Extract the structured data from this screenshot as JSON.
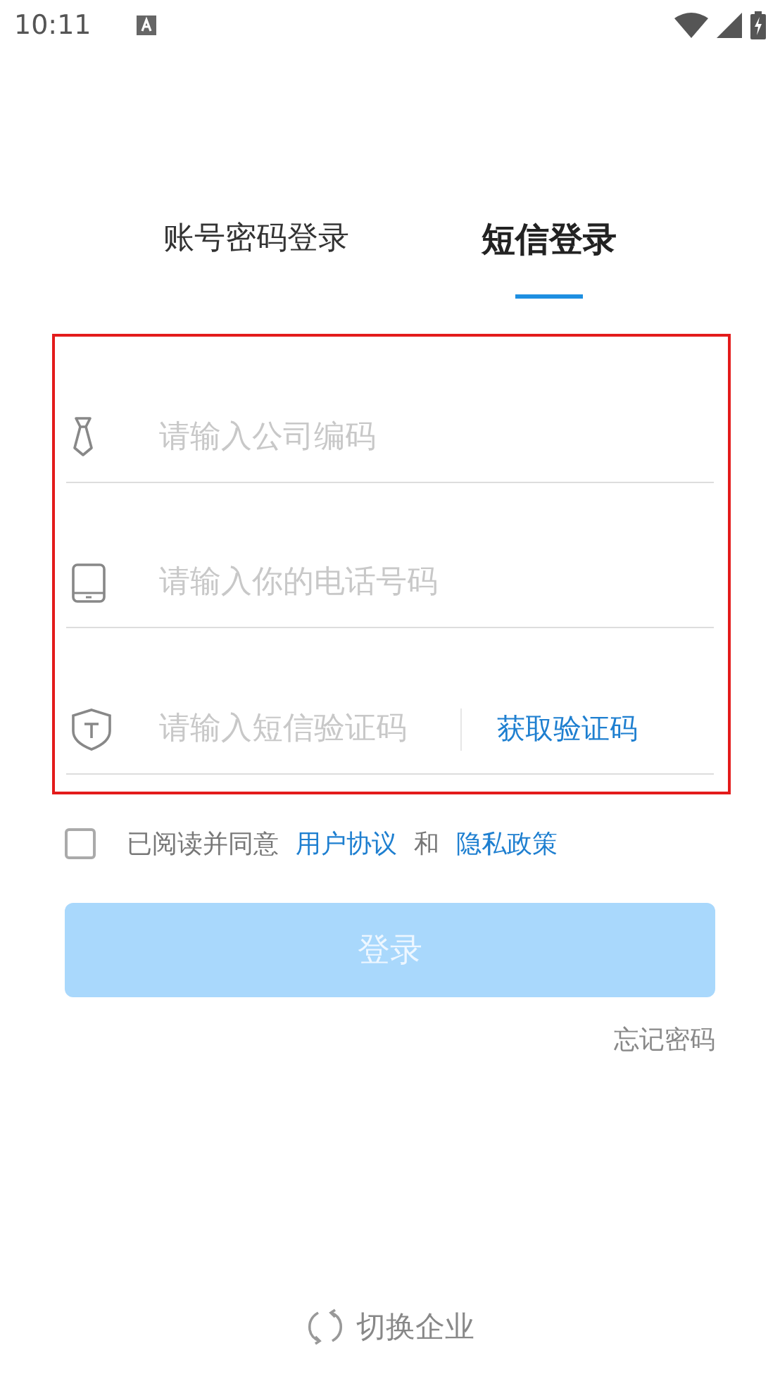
{
  "status_bar": {
    "time": "10:11"
  },
  "tabs": [
    {
      "label": "账号密码登录",
      "selected": false
    },
    {
      "label": "短信登录",
      "selected": true
    }
  ],
  "form": {
    "highlighted": true,
    "fields": [
      {
        "kind": "company",
        "placeholder": "请输入公司编码"
      },
      {
        "kind": "phone",
        "placeholder": "请输入你的电话号码"
      },
      {
        "kind": "code",
        "placeholder": "请输入短信验证码",
        "action": "获取验证码"
      }
    ]
  },
  "agreement": {
    "checked": false,
    "parts": [
      {
        "kind": "text",
        "text": "已阅读并同意"
      },
      {
        "kind": "link",
        "text": "用户协议"
      },
      {
        "kind": "text",
        "text": "和"
      },
      {
        "kind": "link",
        "text": "隐私政策"
      }
    ]
  },
  "login_button": {
    "label": "登录",
    "disabled": true
  },
  "forgot_password": "忘记密码",
  "switch_company": "切换企业"
}
